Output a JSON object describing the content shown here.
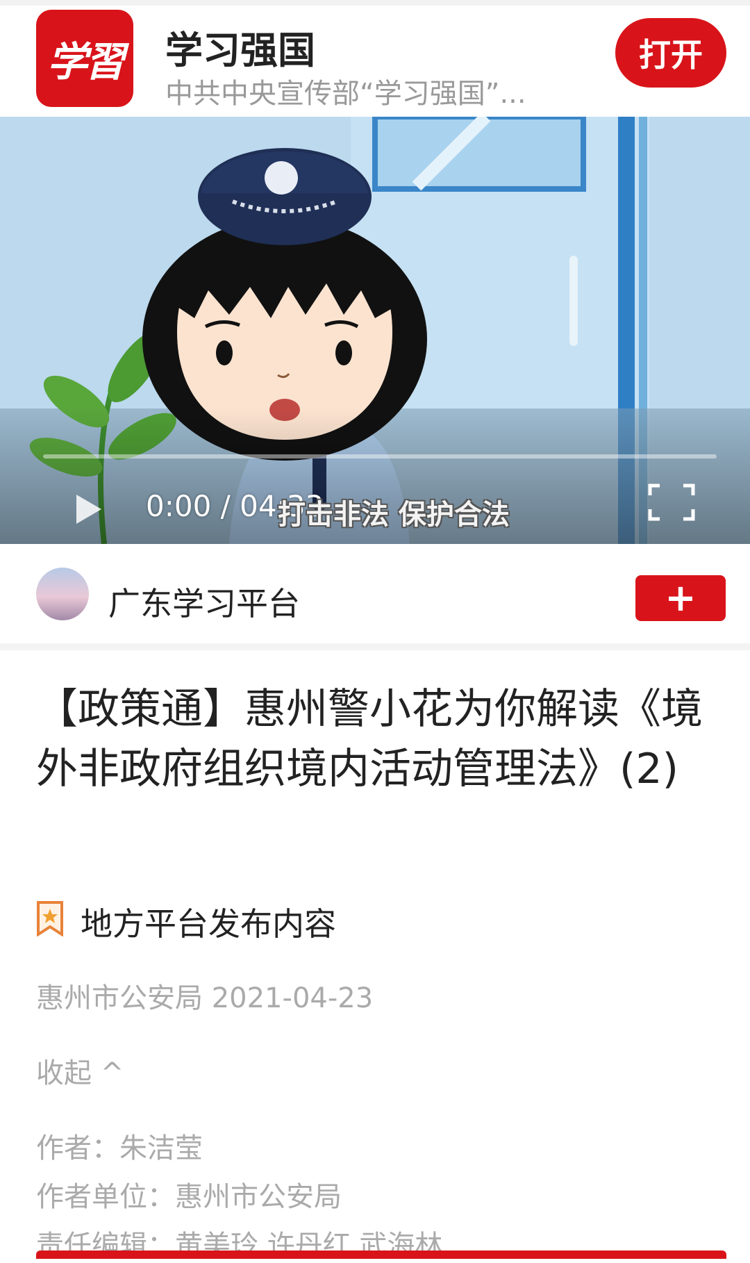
{
  "banner": {
    "logo_text": "学習",
    "app_name": "学习强国",
    "app_subtitle": "中共中央宣传部“学习强国”...",
    "open_label": "打开"
  },
  "video": {
    "time": "0:00 / 04:33",
    "subtitle": "打击非法 保护合法",
    "progress": 0
  },
  "channel": {
    "name": "广东学习平台",
    "follow_label": "+"
  },
  "article": {
    "title": "【政策通】惠州警小花为你解读《境外非政府组织境内活动管理法》(2)",
    "tag_label": "地方平台发布内容",
    "meta": "惠州市公安局 2021-04-23",
    "collapse_label": "收起 ^",
    "author": "作者：朱洁莹",
    "author_unit": "作者单位：惠州市公安局",
    "editors": "责任编辑：黄美玲 许丹红 武海林"
  },
  "colors": {
    "brand_red": "#d8141a",
    "muted_text": "#aaaaaa"
  },
  "icons": [
    "play-icon",
    "fullscreen-icon",
    "bookmark-star-icon"
  ]
}
